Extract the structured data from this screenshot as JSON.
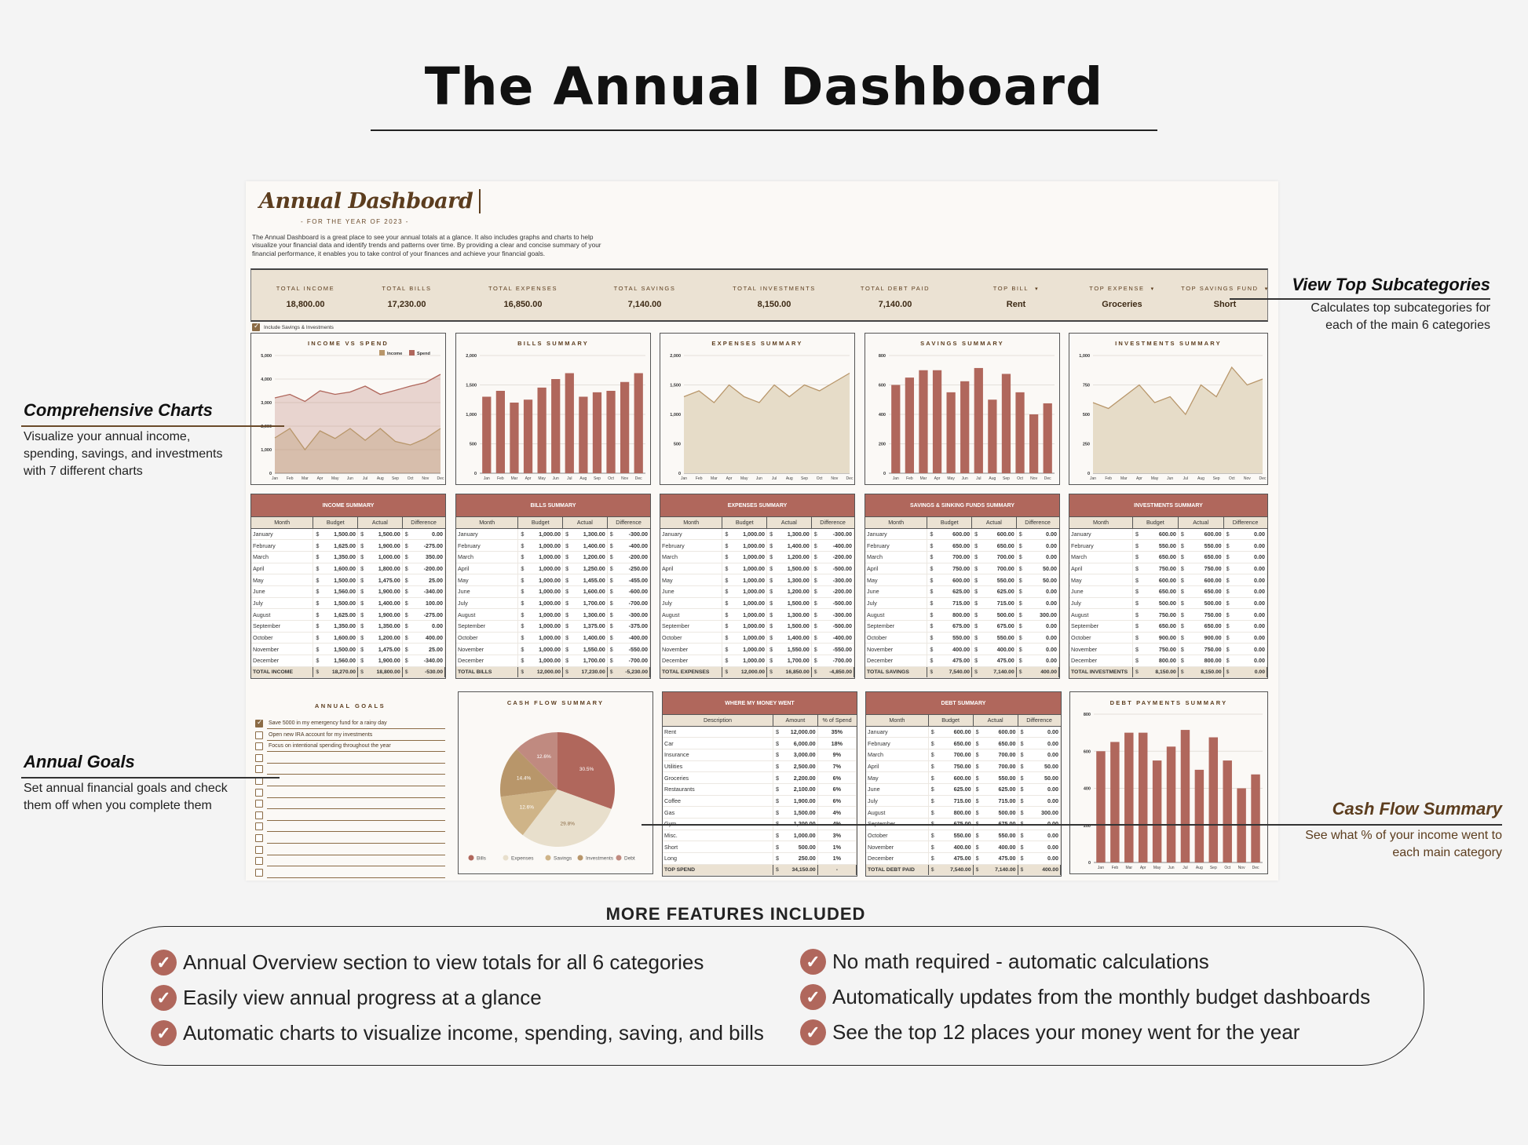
{
  "page": {
    "title": "The Annual Dashboard",
    "annotations": [
      {
        "title": "View Top Subcategories",
        "text": [
          "Calculates top subcategories for",
          "each of the main 6 categories"
        ]
      },
      {
        "title": "Comprehensive Charts",
        "text": [
          "Visualize your annual income,",
          "spending, savings, and investments",
          "with 7 different charts"
        ]
      },
      {
        "title": "Annual Goals",
        "text": [
          "Set annual financial goals and check",
          "them off when you complete them"
        ]
      },
      {
        "title": "Cash Flow Summary",
        "text": [
          "See what % of your income went to",
          "each main category"
        ]
      }
    ],
    "features": {
      "heading": "MORE FEATURES INCLUDED",
      "items": [
        "Annual Overview section to view totals for all 6 categories",
        "Easily view annual progress at a glance",
        "Automatic charts to visualize income, spending, saving, and bills",
        "No math required - automatic calculations",
        "Automatically updates from the monthly budget dashboards",
        "See the top 12 places your money went for the year"
      ]
    }
  },
  "dashboard": {
    "title": "Annual Dashboard",
    "subtitle": "- FOR THE YEAR OF 2023 -",
    "description": "The Annual Dashboard is a great place to see your annual totals at a glance. It also includes graphs and charts to help visualize your financial data and identify trends and patterns over time. By providing a clear and concise summary of your financial performance, it enables you to take control of your finances and achieve your financial goals.",
    "overview": [
      {
        "label": "TOTAL INCOME",
        "value": "18,800.00"
      },
      {
        "label": "TOTAL BILLS",
        "value": "17,230.00"
      },
      {
        "label": "TOTAL EXPENSES",
        "value": "16,850.00"
      },
      {
        "label": "TOTAL SAVINGS",
        "value": "7,140.00"
      },
      {
        "label": "TOTAL INVESTMENTS",
        "value": "8,150.00"
      },
      {
        "label": "TOTAL DEBT PAID",
        "value": "7,140.00"
      },
      {
        "label": "TOP BILL",
        "value": "Rent",
        "dropdown": true
      },
      {
        "label": "TOP EXPENSE",
        "value": "Groceries",
        "dropdown": true
      },
      {
        "label": "TOP SAVINGS FUND",
        "value": "Short",
        "dropdown": true
      }
    ],
    "include_toggle": {
      "label": "Include Savings & Investments",
      "checked": true
    },
    "dropdown_glyph": "▾",
    "currency": "$",
    "check_glyph": "✓"
  },
  "colors": {
    "accent": "#b0675c",
    "band": "#ebe2d3",
    "brown": "#5c3d1e",
    "tan": "#b8966a",
    "area_tan": "#e6dcc8"
  },
  "chart_data": [
    {
      "type": "area",
      "title": "INCOME VS SPEND",
      "categories": [
        "Jan",
        "Feb",
        "Mar",
        "Apr",
        "May",
        "Jun",
        "Jul",
        "Aug",
        "Sep",
        "Oct",
        "Nov",
        "Dec"
      ],
      "series": [
        {
          "name": "Income",
          "values": [
            1500,
            1900,
            1000,
            1800,
            1475,
            1900,
            1400,
            1900,
            1350,
            1200,
            1475,
            1900
          ],
          "color": "#b8966a"
        },
        {
          "name": "Spend",
          "values": [
            3200,
            3350,
            3050,
            3500,
            3350,
            3450,
            3700,
            3350,
            3520,
            3700,
            3850,
            4200
          ],
          "color": "#b0675c"
        }
      ],
      "ylim": [
        0,
        5000
      ],
      "yticks": [
        "0",
        "1,000",
        "2,000",
        "3,000",
        "4,000",
        "5,000"
      ],
      "legend": "top-right",
      "grid": true
    },
    {
      "type": "bar",
      "title": "BILLS SUMMARY",
      "categories": [
        "Jan",
        "Feb",
        "Mar",
        "Apr",
        "May",
        "Jun",
        "Jul",
        "Aug",
        "Sep",
        "Oct",
        "Nov",
        "Dec"
      ],
      "values": [
        1300,
        1400,
        1200,
        1250,
        1455,
        1600,
        1700,
        1300,
        1375,
        1400,
        1550,
        1700
      ],
      "ylim": [
        0,
        2000
      ],
      "yticks": [
        "0",
        "500",
        "1,000",
        "1,500",
        "2,000"
      ],
      "grid": true
    },
    {
      "type": "area",
      "title": "EXPENSES SUMMARY",
      "categories": [
        "Jan",
        "Feb",
        "Mar",
        "Apr",
        "May",
        "Jun",
        "Jul",
        "Aug",
        "Sep",
        "Oct",
        "Nov",
        "Dec"
      ],
      "values": [
        1300,
        1400,
        1200,
        1500,
        1300,
        1200,
        1500,
        1300,
        1500,
        1400,
        1550,
        1700
      ],
      "ylim": [
        0,
        2000
      ],
      "yticks": [
        "0",
        "500",
        "1,000",
        "1,500",
        "2,000"
      ],
      "grid": true
    },
    {
      "type": "bar",
      "title": "SAVINGS SUMMARY",
      "categories": [
        "Jan",
        "Feb",
        "Mar",
        "Apr",
        "May",
        "Jun",
        "Jul",
        "Aug",
        "Sep",
        "Oct",
        "Nov",
        "Dec"
      ],
      "values": [
        600,
        650,
        700,
        700,
        550,
        625,
        715,
        500,
        675,
        550,
        400,
        475
      ],
      "ylim": [
        0,
        800
      ],
      "yticks": [
        "0",
        "200",
        "400",
        "600",
        "800"
      ],
      "grid": true
    },
    {
      "type": "area",
      "title": "INVESTMENTS SUMMARY",
      "categories": [
        "Jan",
        "Feb",
        "Mar",
        "Apr",
        "May",
        "Jun",
        "Jul",
        "Aug",
        "Sep",
        "Oct",
        "Nov",
        "Dec"
      ],
      "values": [
        600,
        550,
        650,
        750,
        600,
        650,
        500,
        750,
        650,
        900,
        750,
        800
      ],
      "ylim": [
        0,
        1000
      ],
      "yticks": [
        "0",
        "250",
        "500",
        "750",
        "1,000"
      ],
      "grid": true
    },
    {
      "type": "pie",
      "title": "CASH FLOW SUMMARY",
      "slices": [
        {
          "name": "Bills",
          "value": 30.5,
          "label": "30.5%",
          "color": "#b0675c"
        },
        {
          "name": "Expenses",
          "value": 29.8,
          "label": "29.8%",
          "color": "#e8dfcc"
        },
        {
          "name": "Savings",
          "value": 12.6,
          "label": "12.6%",
          "color": "#cfb488"
        },
        {
          "name": "Investments",
          "value": 14.4,
          "label": "14.4%",
          "color": "#b8966a"
        },
        {
          "name": "Debt",
          "value": 12.6,
          "label": "12.6%",
          "color": "#c08a80"
        }
      ],
      "legend": "bottom"
    },
    {
      "type": "bar",
      "title": "DEBT PAYMENTS SUMMARY",
      "categories": [
        "Jan",
        "Feb",
        "Mar",
        "Apr",
        "May",
        "Jun",
        "Jul",
        "Aug",
        "Sep",
        "Oct",
        "Nov",
        "Dec"
      ],
      "values": [
        600,
        650,
        700,
        700,
        550,
        625,
        715,
        500,
        675,
        550,
        400,
        475
      ],
      "ylim": [
        0,
        800
      ],
      "yticks": [
        "0",
        "200",
        "400",
        "600",
        "800"
      ],
      "grid": true
    }
  ],
  "tables": [
    {
      "title": "INCOME SUMMARY",
      "columns": [
        "Month",
        "Budget",
        "Actual",
        "Difference"
      ],
      "rows": [
        [
          "January",
          "1,500.00",
          "1,500.00",
          "0.00"
        ],
        [
          "February",
          "1,625.00",
          "1,900.00",
          "-275.00"
        ],
        [
          "March",
          "1,350.00",
          "1,000.00",
          "350.00"
        ],
        [
          "April",
          "1,600.00",
          "1,800.00",
          "-200.00"
        ],
        [
          "May",
          "1,500.00",
          "1,475.00",
          "25.00"
        ],
        [
          "June",
          "1,560.00",
          "1,900.00",
          "-340.00"
        ],
        [
          "July",
          "1,500.00",
          "1,400.00",
          "100.00"
        ],
        [
          "August",
          "1,625.00",
          "1,900.00",
          "-275.00"
        ],
        [
          "September",
          "1,350.00",
          "1,350.00",
          "0.00"
        ],
        [
          "October",
          "1,600.00",
          "1,200.00",
          "400.00"
        ],
        [
          "November",
          "1,500.00",
          "1,475.00",
          "25.00"
        ],
        [
          "December",
          "1,560.00",
          "1,900.00",
          "-340.00"
        ]
      ],
      "total": [
        "TOTAL INCOME",
        "18,270.00",
        "18,800.00",
        "-530.00"
      ]
    },
    {
      "title": "BILLS SUMMARY",
      "columns": [
        "Month",
        "Budget",
        "Actual",
        "Difference"
      ],
      "rows": [
        [
          "January",
          "1,000.00",
          "1,300.00",
          "-300.00"
        ],
        [
          "February",
          "1,000.00",
          "1,400.00",
          "-400.00"
        ],
        [
          "March",
          "1,000.00",
          "1,200.00",
          "-200.00"
        ],
        [
          "April",
          "1,000.00",
          "1,250.00",
          "-250.00"
        ],
        [
          "May",
          "1,000.00",
          "1,455.00",
          "-455.00"
        ],
        [
          "June",
          "1,000.00",
          "1,600.00",
          "-600.00"
        ],
        [
          "July",
          "1,000.00",
          "1,700.00",
          "-700.00"
        ],
        [
          "August",
          "1,000.00",
          "1,300.00",
          "-300.00"
        ],
        [
          "September",
          "1,000.00",
          "1,375.00",
          "-375.00"
        ],
        [
          "October",
          "1,000.00",
          "1,400.00",
          "-400.00"
        ],
        [
          "November",
          "1,000.00",
          "1,550.00",
          "-550.00"
        ],
        [
          "December",
          "1,000.00",
          "1,700.00",
          "-700.00"
        ]
      ],
      "total": [
        "TOTAL BILLS",
        "12,000.00",
        "17,230.00",
        "-5,230.00"
      ]
    },
    {
      "title": "EXPENSES SUMMARY",
      "columns": [
        "Month",
        "Budget",
        "Actual",
        "Difference"
      ],
      "rows": [
        [
          "January",
          "1,000.00",
          "1,300.00",
          "-300.00"
        ],
        [
          "February",
          "1,000.00",
          "1,400.00",
          "-400.00"
        ],
        [
          "March",
          "1,000.00",
          "1,200.00",
          "-200.00"
        ],
        [
          "April",
          "1,000.00",
          "1,500.00",
          "-500.00"
        ],
        [
          "May",
          "1,000.00",
          "1,300.00",
          "-300.00"
        ],
        [
          "June",
          "1,000.00",
          "1,200.00",
          "-200.00"
        ],
        [
          "July",
          "1,000.00",
          "1,500.00",
          "-500.00"
        ],
        [
          "August",
          "1,000.00",
          "1,300.00",
          "-300.00"
        ],
        [
          "September",
          "1,000.00",
          "1,500.00",
          "-500.00"
        ],
        [
          "October",
          "1,000.00",
          "1,400.00",
          "-400.00"
        ],
        [
          "November",
          "1,000.00",
          "1,550.00",
          "-550.00"
        ],
        [
          "December",
          "1,000.00",
          "1,700.00",
          "-700.00"
        ]
      ],
      "total": [
        "TOTAL EXPENSES",
        "12,000.00",
        "16,850.00",
        "-4,850.00"
      ]
    },
    {
      "title": "SAVINGS & SINKING FUNDS SUMMARY",
      "columns": [
        "Month",
        "Budget",
        "Actual",
        "Difference"
      ],
      "rows": [
        [
          "January",
          "600.00",
          "600.00",
          "0.00"
        ],
        [
          "February",
          "650.00",
          "650.00",
          "0.00"
        ],
        [
          "March",
          "700.00",
          "700.00",
          "0.00"
        ],
        [
          "April",
          "750.00",
          "700.00",
          "50.00"
        ],
        [
          "May",
          "600.00",
          "550.00",
          "50.00"
        ],
        [
          "June",
          "625.00",
          "625.00",
          "0.00"
        ],
        [
          "July",
          "715.00",
          "715.00",
          "0.00"
        ],
        [
          "August",
          "800.00",
          "500.00",
          "300.00"
        ],
        [
          "September",
          "675.00",
          "675.00",
          "0.00"
        ],
        [
          "October",
          "550.00",
          "550.00",
          "0.00"
        ],
        [
          "November",
          "400.00",
          "400.00",
          "0.00"
        ],
        [
          "December",
          "475.00",
          "475.00",
          "0.00"
        ]
      ],
      "total": [
        "TOTAL SAVINGS",
        "7,540.00",
        "7,140.00",
        "400.00"
      ]
    },
    {
      "title": "INVESTMENTS SUMMARY",
      "columns": [
        "Month",
        "Budget",
        "Actual",
        "Difference"
      ],
      "rows": [
        [
          "January",
          "600.00",
          "600.00",
          "0.00"
        ],
        [
          "February",
          "550.00",
          "550.00",
          "0.00"
        ],
        [
          "March",
          "650.00",
          "650.00",
          "0.00"
        ],
        [
          "April",
          "750.00",
          "750.00",
          "0.00"
        ],
        [
          "May",
          "600.00",
          "600.00",
          "0.00"
        ],
        [
          "June",
          "650.00",
          "650.00",
          "0.00"
        ],
        [
          "July",
          "500.00",
          "500.00",
          "0.00"
        ],
        [
          "August",
          "750.00",
          "750.00",
          "0.00"
        ],
        [
          "September",
          "650.00",
          "650.00",
          "0.00"
        ],
        [
          "October",
          "900.00",
          "900.00",
          "0.00"
        ],
        [
          "November",
          "750.00",
          "750.00",
          "0.00"
        ],
        [
          "December",
          "800.00",
          "800.00",
          "0.00"
        ]
      ],
      "total": [
        "TOTAL INVESTMENTS",
        "8,150.00",
        "8,150.00",
        "0.00"
      ]
    },
    {
      "title": "DEBT SUMMARY",
      "columns": [
        "Month",
        "Budget",
        "Actual",
        "Difference"
      ],
      "rows": [
        [
          "January",
          "600.00",
          "600.00",
          "0.00"
        ],
        [
          "February",
          "650.00",
          "650.00",
          "0.00"
        ],
        [
          "March",
          "700.00",
          "700.00",
          "0.00"
        ],
        [
          "April",
          "750.00",
          "700.00",
          "50.00"
        ],
        [
          "May",
          "600.00",
          "550.00",
          "50.00"
        ],
        [
          "June",
          "625.00",
          "625.00",
          "0.00"
        ],
        [
          "July",
          "715.00",
          "715.00",
          "0.00"
        ],
        [
          "August",
          "800.00",
          "500.00",
          "300.00"
        ],
        [
          "September",
          "675.00",
          "675.00",
          "0.00"
        ],
        [
          "October",
          "550.00",
          "550.00",
          "0.00"
        ],
        [
          "November",
          "400.00",
          "400.00",
          "0.00"
        ],
        [
          "December",
          "475.00",
          "475.00",
          "0.00"
        ]
      ],
      "total": [
        "TOTAL DEBT PAID",
        "7,540.00",
        "7,140.00",
        "400.00"
      ]
    }
  ],
  "money_went": {
    "title": "WHERE MY MONEY WENT",
    "columns": [
      "Description",
      "Amount",
      "% of Spend"
    ],
    "rows": [
      [
        "Rent",
        "12,000.00",
        "35%"
      ],
      [
        "Car",
        "6,000.00",
        "18%"
      ],
      [
        "Insurance",
        "3,000.00",
        "9%"
      ],
      [
        "Utilities",
        "2,500.00",
        "7%"
      ],
      [
        "Groceries",
        "2,200.00",
        "6%"
      ],
      [
        "Restaurants",
        "2,100.00",
        "6%"
      ],
      [
        "Coffee",
        "1,900.00",
        "6%"
      ],
      [
        "Gas",
        "1,500.00",
        "4%"
      ],
      [
        "Gym",
        "1,200.00",
        "4%"
      ],
      [
        "Misc.",
        "1,000.00",
        "3%"
      ],
      [
        "Short",
        "500.00",
        "1%"
      ],
      [
        "Long",
        "250.00",
        "1%"
      ]
    ],
    "total": [
      "TOP SPEND",
      "34,150.00",
      "-"
    ]
  },
  "goals": {
    "title": "ANNUAL GOALS",
    "items": [
      {
        "text": "Save 5000 in my emergency fund for a rainy day",
        "checked": true
      },
      {
        "text": "Open new IRA account for my investments",
        "checked": false
      },
      {
        "text": "Focus on intentional spending throughout the year",
        "checked": false
      },
      {
        "text": "",
        "checked": false
      },
      {
        "text": "",
        "checked": false
      },
      {
        "text": "",
        "checked": false
      },
      {
        "text": "",
        "checked": false
      },
      {
        "text": "",
        "checked": false
      },
      {
        "text": "",
        "checked": false
      },
      {
        "text": "",
        "checked": false
      },
      {
        "text": "",
        "checked": false
      },
      {
        "text": "",
        "checked": false
      },
      {
        "text": "",
        "checked": false
      },
      {
        "text": "",
        "checked": false
      }
    ]
  }
}
